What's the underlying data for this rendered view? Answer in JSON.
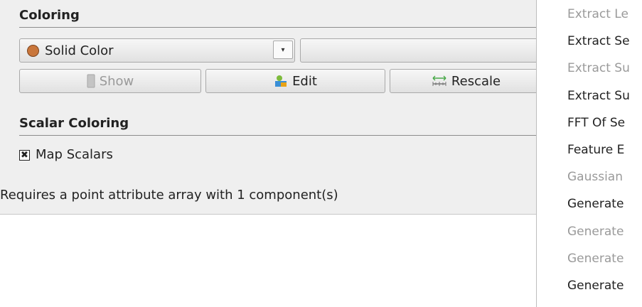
{
  "coloring": {
    "section_title": "Coloring",
    "combo_value": "Solid Color",
    "combo_arrow": "▾",
    "show_label": "Show",
    "edit_label": "Edit",
    "rescale_label": "Rescale"
  },
  "scalar_coloring": {
    "section_title": "Scalar Coloring",
    "checkbox_mark": "✖",
    "map_scalars_label": "Map Scalars",
    "map_scalars_checked": true,
    "requirement_text": "Requires a point attribute array with 1 component(s)"
  },
  "filter_menu": {
    "items": [
      {
        "label": "Extract Le",
        "enabled": false
      },
      {
        "label": "Extract Se",
        "enabled": true
      },
      {
        "label": "Extract Su",
        "enabled": false
      },
      {
        "label": "Extract Su",
        "enabled": true
      },
      {
        "label": "FFT Of Se",
        "enabled": true
      },
      {
        "label": "Feature E",
        "enabled": true
      },
      {
        "label": "Gaussian",
        "enabled": false
      },
      {
        "label": "Generate",
        "enabled": true
      },
      {
        "label": "Generate",
        "enabled": false
      },
      {
        "label": "Generate",
        "enabled": false
      },
      {
        "label": "Generate",
        "enabled": true
      }
    ]
  },
  "colors": {
    "solid_color_swatch": "#c9763b",
    "disabled_text": "#9a9a9a"
  }
}
